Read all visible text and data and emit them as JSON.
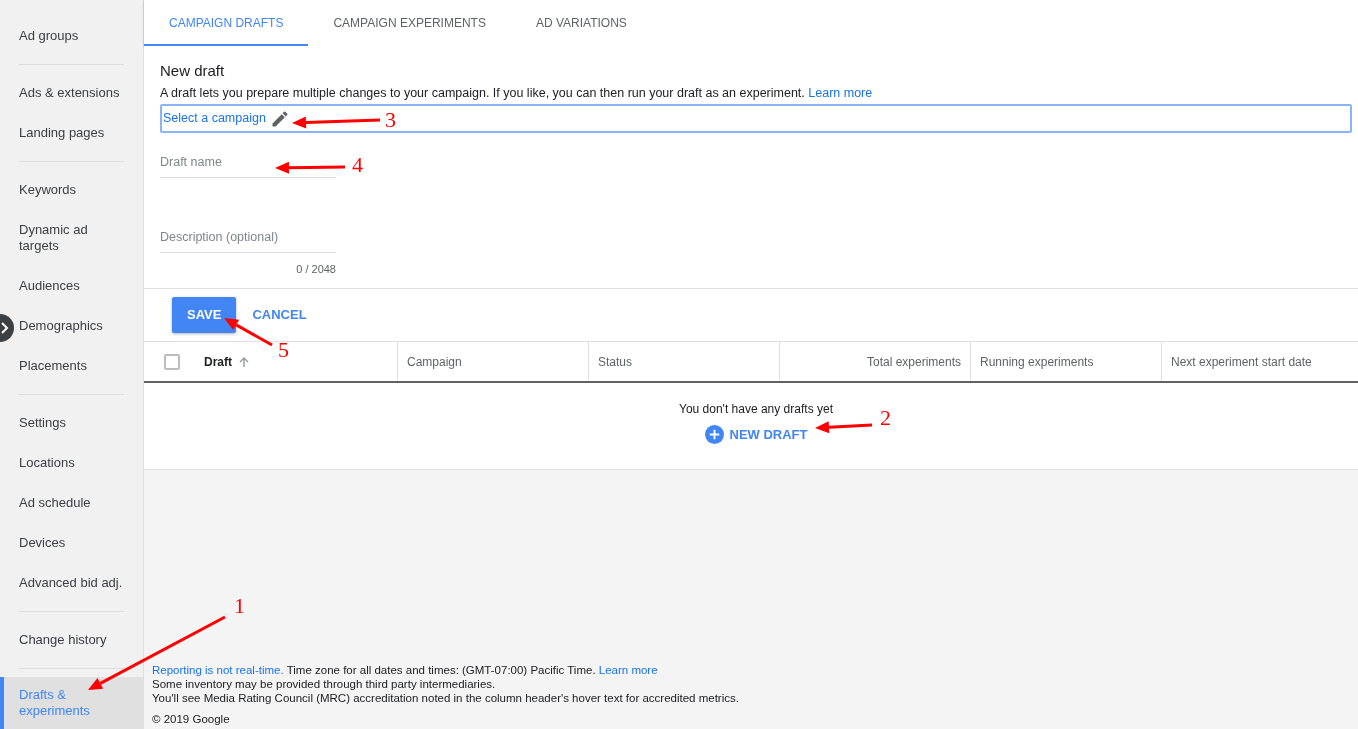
{
  "sidebar": {
    "groups": [
      [
        {
          "label": "Ad groups",
          "selected": false
        }
      ],
      [
        {
          "label": "Ads & extensions",
          "selected": false
        },
        {
          "label": "Landing pages",
          "selected": false
        }
      ],
      [
        {
          "label": "Keywords",
          "selected": false
        },
        {
          "label": "Dynamic ad targets",
          "selected": false
        },
        {
          "label": "Audiences",
          "selected": false
        },
        {
          "label": "Demographics",
          "selected": false
        },
        {
          "label": "Placements",
          "selected": false
        }
      ],
      [
        {
          "label": "Settings",
          "selected": false
        },
        {
          "label": "Locations",
          "selected": false
        },
        {
          "label": "Ad schedule",
          "selected": false
        },
        {
          "label": "Devices",
          "selected": false
        },
        {
          "label": "Advanced bid adj.",
          "selected": false
        }
      ],
      [
        {
          "label": "Change history",
          "selected": false
        }
      ],
      [
        {
          "label": "Drafts & experiments",
          "selected": true
        }
      ]
    ]
  },
  "tabs": [
    {
      "label": "CAMPAIGN DRAFTS",
      "selected": true
    },
    {
      "label": "CAMPAIGN EXPERIMENTS",
      "selected": false
    },
    {
      "label": "AD VARIATIONS",
      "selected": false
    }
  ],
  "draft_form": {
    "title": "New draft",
    "description": "A draft lets you prepare multiple changes to your campaign. If you like, you can then run your draft as an experiment.",
    "learn_more": "Learn more",
    "campaign_field": {
      "value": "Select a campaign"
    },
    "name_field": {
      "placeholder": "Draft name"
    },
    "description_field": {
      "placeholder": "Description (optional)",
      "counter": "0 / 2048"
    }
  },
  "actions": [
    {
      "label": "SAVE",
      "kind": "primary"
    },
    {
      "label": "CANCEL",
      "kind": "text"
    }
  ],
  "table": {
    "select_all": {
      "checked": false
    },
    "columns": [
      {
        "label": "Draft",
        "sorted": true,
        "kind": "text"
      },
      {
        "label": "Campaign",
        "sorted": false,
        "kind": "text"
      },
      {
        "label": "Status",
        "sorted": false,
        "kind": "text"
      },
      {
        "label": "Total experiments",
        "sorted": false,
        "kind": "number"
      },
      {
        "label": "Running experiments",
        "sorted": false,
        "kind": "text"
      },
      {
        "label": "Next experiment start date",
        "sorted": false,
        "kind": "text"
      }
    ],
    "empty_message": "You don't have any drafts yet",
    "empty_action": "NEW DRAFT"
  },
  "footer": {
    "realtime_link": "Reporting is not real-time.",
    "timezone": "Time zone for all dates and times: (GMT-07:00) Pacific Time.",
    "learn_more": "Learn more",
    "lines": [
      "Some inventory may be provided through third party intermediaries.",
      "You'll see Media Rating Council (MRC) accreditation noted in the column header's hover text for accredited metrics."
    ],
    "copyright": "© 2019 Google"
  },
  "annotations": [
    {
      "label": "1"
    },
    {
      "label": "2"
    },
    {
      "label": "3"
    },
    {
      "label": "4"
    },
    {
      "label": "5"
    }
  ]
}
